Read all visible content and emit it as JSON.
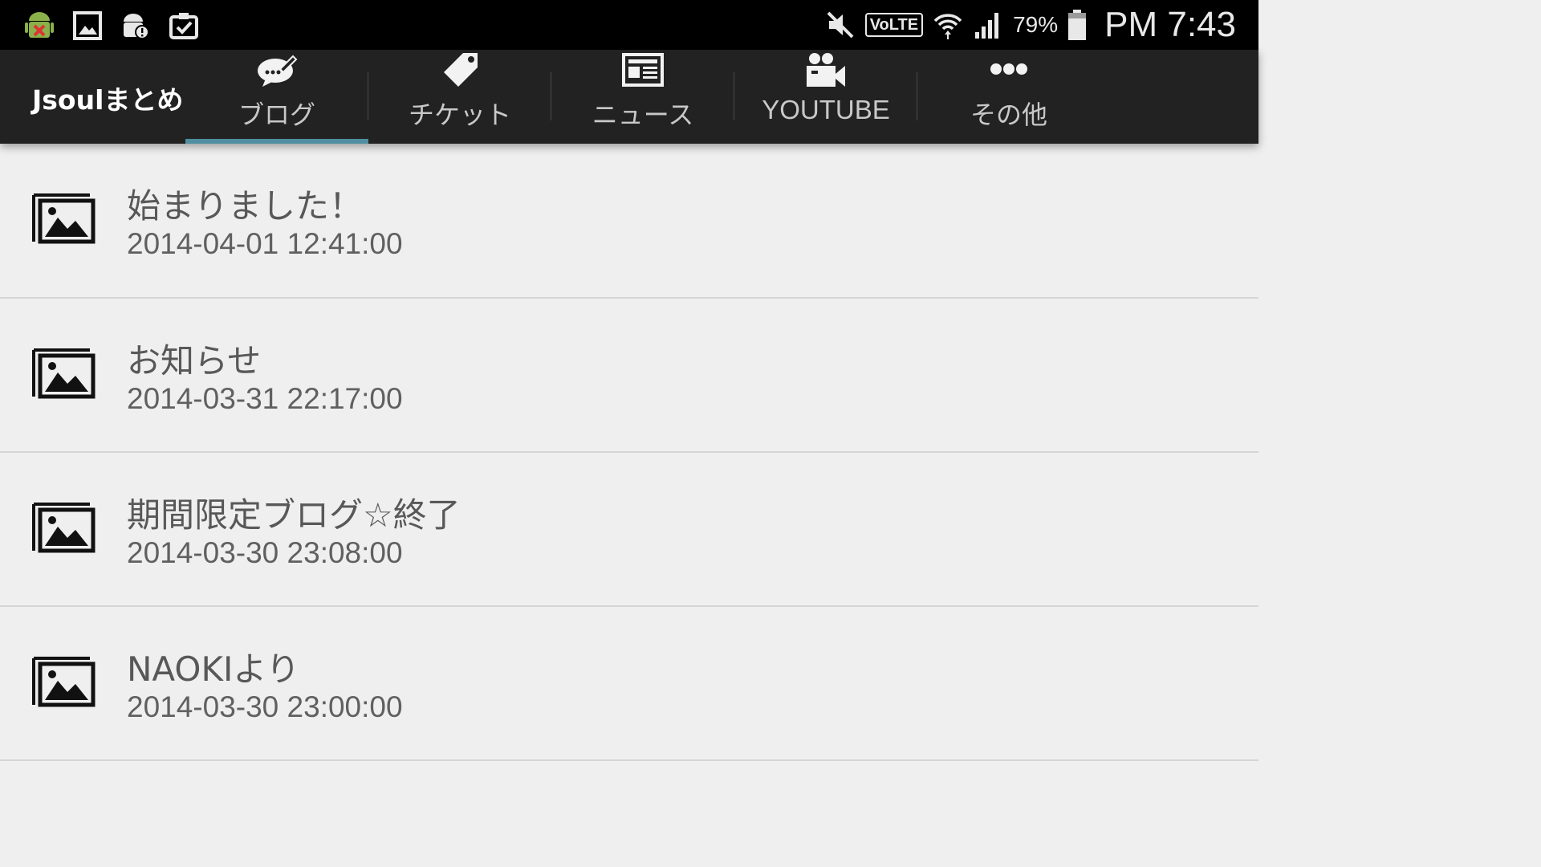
{
  "status_bar": {
    "left_icons": [
      "android-debug-icon",
      "image-notification-icon",
      "android-alert-icon",
      "clipboard-check-icon"
    ],
    "right_icons": [
      "mute-icon",
      "volte-icon",
      "wifi-icon",
      "signal-icon",
      "battery-icon"
    ],
    "volte_label": "VoLTE",
    "battery_percent": "79%",
    "time": "PM 7:43"
  },
  "app_bar": {
    "title": "Jsoulまとめ",
    "tabs": [
      {
        "label": "ブログ",
        "icon": "blog-chat-icon",
        "active": true
      },
      {
        "label": "チケット",
        "icon": "ticket-tag-icon",
        "active": false
      },
      {
        "label": "ニュース",
        "icon": "newspaper-icon",
        "active": false
      },
      {
        "label": "YOUTUBE",
        "icon": "video-camera-icon",
        "active": false
      },
      {
        "label": "その他",
        "icon": "more-dots-icon",
        "active": false
      }
    ],
    "accent_color": "#4f8fa0"
  },
  "list": {
    "items": [
      {
        "title": "始まりました！",
        "date": "2014-04-01 12:41:00",
        "icon": "image-placeholder-icon"
      },
      {
        "title": "お知らせ",
        "date": "2014-03-31 22:17:00",
        "icon": "image-placeholder-icon"
      },
      {
        "title": "期間限定ブログ☆終了",
        "date": "2014-03-30 23:08:00",
        "icon": "image-placeholder-icon"
      },
      {
        "title": "NAOKIより",
        "date": "2014-03-30 23:00:00",
        "icon": "image-placeholder-icon"
      }
    ]
  }
}
